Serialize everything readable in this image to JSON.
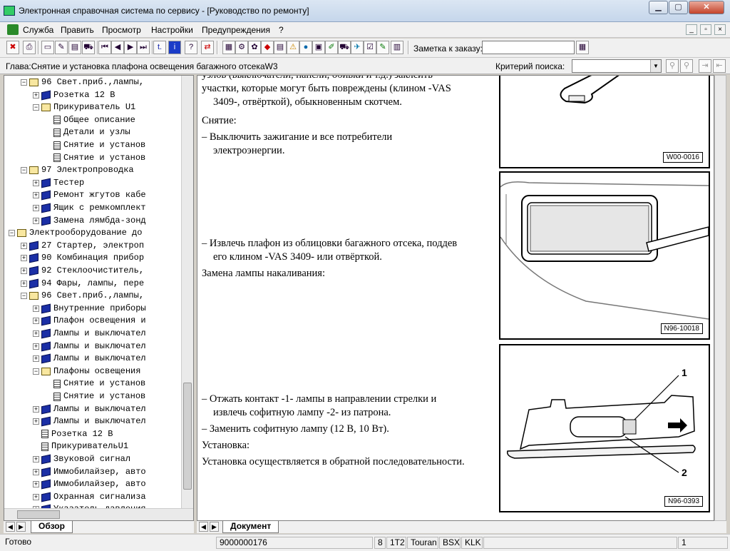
{
  "window": {
    "title": "Электронная справочная система по сервису - [Руководство по ремонту]"
  },
  "menu": [
    "Служба",
    "Править",
    "Просмотр",
    "Настройки",
    "Предупреждения",
    "?"
  ],
  "toolbar": {
    "note_label": "Заметка к заказу:"
  },
  "chapter": {
    "text": "Глава:Снятие и установка плафона освещения багажного отсекаW3",
    "criteria_label": "Критерий поиска:"
  },
  "tree": [
    {
      "indent": 2,
      "exp": "−",
      "icon": "open",
      "text": "96 Свет.приб.,лампы,"
    },
    {
      "indent": 3,
      "exp": "+",
      "icon": "book",
      "text": "Розетка 12 В"
    },
    {
      "indent": 3,
      "exp": "−",
      "icon": "open",
      "text": "Прикуриватель U1"
    },
    {
      "indent": 4,
      "exp": "",
      "icon": "page",
      "text": "Общее описание"
    },
    {
      "indent": 4,
      "exp": "",
      "icon": "page",
      "text": "Детали и узлы"
    },
    {
      "indent": 4,
      "exp": "",
      "icon": "page",
      "text": "Снятие и установ"
    },
    {
      "indent": 4,
      "exp": "",
      "icon": "page",
      "text": "Снятие и установ"
    },
    {
      "indent": 2,
      "exp": "−",
      "icon": "open",
      "text": "97 Электропроводка"
    },
    {
      "indent": 3,
      "exp": "+",
      "icon": "book",
      "text": "Тестер"
    },
    {
      "indent": 3,
      "exp": "+",
      "icon": "book",
      "text": "Ремонт жгутов кабе"
    },
    {
      "indent": 3,
      "exp": "+",
      "icon": "book",
      "text": "Ящик с ремкомплект"
    },
    {
      "indent": 3,
      "exp": "+",
      "icon": "book",
      "text": "Замена лямбда-зонд"
    },
    {
      "indent": 1,
      "exp": "−",
      "icon": "open",
      "text": "Электрооборудование до"
    },
    {
      "indent": 2,
      "exp": "+",
      "icon": "book",
      "text": "27 Стартер, электроп"
    },
    {
      "indent": 2,
      "exp": "+",
      "icon": "book",
      "text": "90 Комбинация прибор"
    },
    {
      "indent": 2,
      "exp": "+",
      "icon": "book",
      "text": "92 Стеклоочиститель,"
    },
    {
      "indent": 2,
      "exp": "+",
      "icon": "book",
      "text": "94 Фары, лампы, пере"
    },
    {
      "indent": 2,
      "exp": "−",
      "icon": "open",
      "text": "96 Свет.приб.,лампы,"
    },
    {
      "indent": 3,
      "exp": "+",
      "icon": "book",
      "text": "Внутренние приборы"
    },
    {
      "indent": 3,
      "exp": "+",
      "icon": "book",
      "text": "Плафон освещения и"
    },
    {
      "indent": 3,
      "exp": "+",
      "icon": "book",
      "text": "Лампы и выключател"
    },
    {
      "indent": 3,
      "exp": "+",
      "icon": "book",
      "text": "Лампы и выключател"
    },
    {
      "indent": 3,
      "exp": "+",
      "icon": "book",
      "text": "Лампы и выключател"
    },
    {
      "indent": 3,
      "exp": "−",
      "icon": "open",
      "text": "Плафоны освещения"
    },
    {
      "indent": 4,
      "exp": "",
      "icon": "page",
      "text": "Снятие и установ"
    },
    {
      "indent": 4,
      "exp": "",
      "icon": "page",
      "text": "Снятие и установ"
    },
    {
      "indent": 3,
      "exp": "+",
      "icon": "book",
      "text": "Лампы и выключател"
    },
    {
      "indent": 3,
      "exp": "+",
      "icon": "book",
      "text": "Лампы и выключател"
    },
    {
      "indent": 3,
      "exp": "",
      "icon": "page",
      "text": "Розетка 12 В"
    },
    {
      "indent": 3,
      "exp": "",
      "icon": "page",
      "text": "ПрикуривательU1"
    },
    {
      "indent": 3,
      "exp": "+",
      "icon": "book",
      "text": "Звуковой сигнал"
    },
    {
      "indent": 3,
      "exp": "+",
      "icon": "book",
      "text": "Иммобилайзер, авто"
    },
    {
      "indent": 3,
      "exp": "+",
      "icon": "book",
      "text": "Иммобилайзер, авто"
    },
    {
      "indent": 3,
      "exp": "+",
      "icon": "book",
      "text": "Охранная сигнализа"
    },
    {
      "indent": 3,
      "exp": "+",
      "icon": "book",
      "text": "Указатель давления"
    }
  ],
  "tabs": {
    "left": "Обзор",
    "right": "Документ"
  },
  "doc": {
    "lines": [
      "узлов (выключатели, панели, обивки и т.д.) заклеить",
      "участки, которые могут быть повреждены (клином -VAS",
      "3409-, отвёрткой), обыкновенным скотчем.",
      "Снятие:",
      "–  Выключить зажигание и все потребители",
      "электроэнергии.",
      "–  Извлечь плафон из облицовки багажного отсека, поддев",
      "его клином -VAS 3409- или отвёрткой.",
      "Замена лампы накаливания:",
      "–  Отжать контакт -1- лампы в направлении стрелки и",
      "извлечь софитную лампу -2- из патрона.",
      "–  Заменить софитную лампу (12 В, 10 Вт).",
      "Установка:",
      "Установка осуществляется в обратной последовательности."
    ],
    "figures": [
      "W00-0016",
      "N96-10018",
      "N96-0393"
    ],
    "callouts": [
      "1",
      "2"
    ]
  },
  "status": {
    "ready": "Готово",
    "number": "9000000176",
    "f1": "8",
    "f2": "1T2",
    "f3": "Touran",
    "f4": "BSX",
    "f5": "KLK",
    "page": "1"
  }
}
